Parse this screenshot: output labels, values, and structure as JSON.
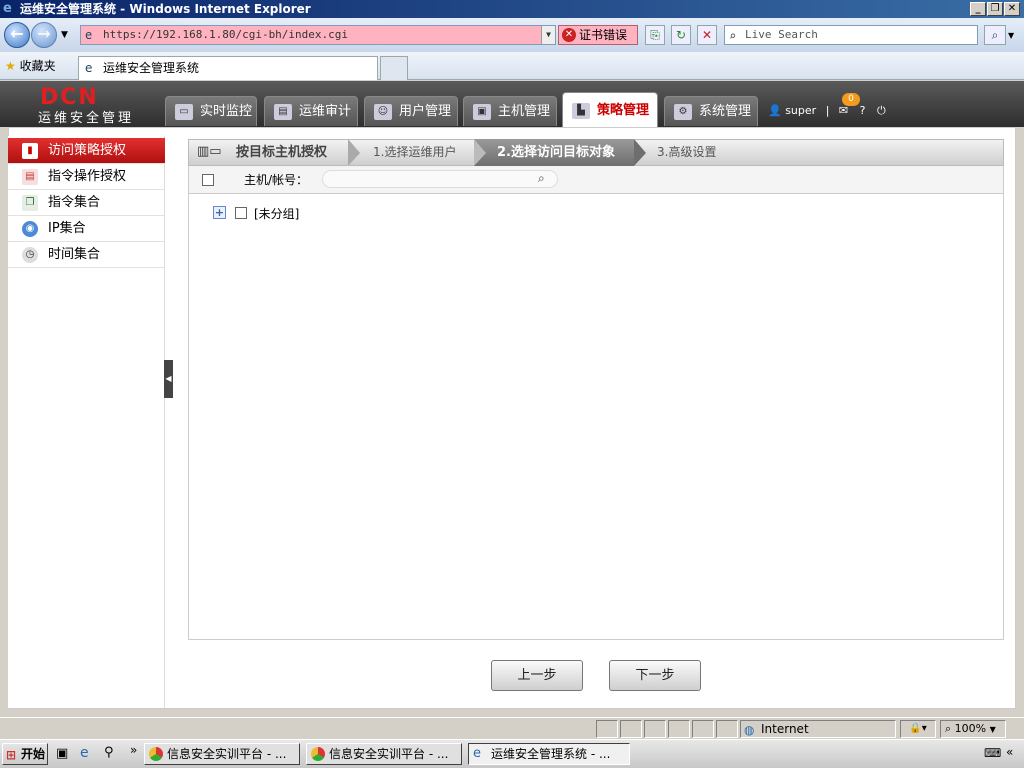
{
  "window": {
    "title": "运维安全管理系统 - Windows Internet Explorer"
  },
  "browser": {
    "url": "https://192.168.1.80/cgi-bh/index.cgi",
    "cert_error": "证书错误",
    "search_placeholder": "Live Search",
    "favorites_label": "收藏夹",
    "tab_title": "运维安全管理系统",
    "status_zone": "Internet",
    "zoom": "100%"
  },
  "app": {
    "logo": "DCN",
    "logo_sub": "运维安全管理",
    "nav": [
      "实时监控",
      "运维审计",
      "用户管理",
      "主机管理",
      "策略管理",
      "系统管理"
    ],
    "active_nav": "策略管理",
    "user": "super",
    "mail_count": "0"
  },
  "sidebar": {
    "items": [
      "访问策略授权",
      "指令操作授权",
      "指令集合",
      "IP集合",
      "时间集合"
    ],
    "active": "访问策略授权"
  },
  "wizard": {
    "title": "按目标主机授权",
    "steps": [
      "1.选择运维用户",
      "2.选择访问目标对象",
      "3.高级设置"
    ],
    "current_step": "2.选择访问目标对象"
  },
  "filter": {
    "host_label": "主机/帐号："
  },
  "tree": {
    "group": "[未分组]"
  },
  "buttons": {
    "prev": "上一步",
    "next": "下一步"
  },
  "taskbar": {
    "start": "开始",
    "tasks": [
      "信息安全实训平台 - ...",
      "信息安全实训平台 - ...",
      "运维安全管理系统 - ..."
    ]
  }
}
